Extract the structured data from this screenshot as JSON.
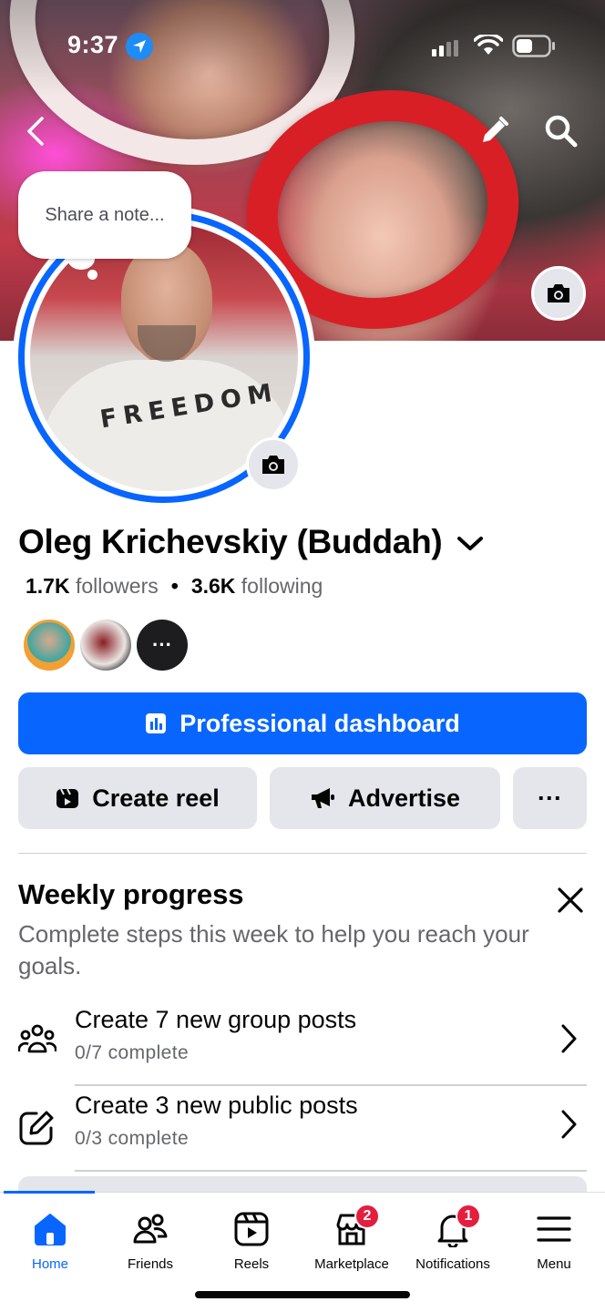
{
  "status_bar": {
    "time": "9:37"
  },
  "note": {
    "placeholder": "Share a note..."
  },
  "avatar": {
    "shirt_text": "FREEDOM"
  },
  "profile": {
    "name": "Oleg Krichevskiy (Buddah)",
    "followers_count": "1.7K",
    "followers_label": "followers",
    "following_count": "3.6K",
    "following_label": "following",
    "mini_avatar_more": "···"
  },
  "actions": {
    "professional_dashboard": "Professional dashboard",
    "create_reel": "Create reel",
    "advertise": "Advertise",
    "more": "···"
  },
  "weekly_progress": {
    "title": "Weekly progress",
    "description": "Complete steps this week to help you reach your goals.",
    "tasks": [
      {
        "title": "Create 7 new group posts",
        "progress": "0/7 complete",
        "icon": "group-icon"
      },
      {
        "title": "Create 3 new public posts",
        "progress": "0/3 complete",
        "icon": "edit-square-icon"
      }
    ]
  },
  "tabbar": {
    "tabs": [
      {
        "label": "Home",
        "icon": "home-icon",
        "active": true
      },
      {
        "label": "Friends",
        "icon": "friends-icon"
      },
      {
        "label": "Reels",
        "icon": "reels-icon"
      },
      {
        "label": "Marketplace",
        "icon": "marketplace-icon",
        "badge": "2"
      },
      {
        "label": "Notifications",
        "icon": "bell-icon",
        "badge": "1"
      },
      {
        "label": "Menu",
        "icon": "menu-icon"
      }
    ]
  },
  "colors": {
    "accent": "#0866ff",
    "badge": "#e41e3f",
    "button_gray": "#e4e6eb"
  }
}
